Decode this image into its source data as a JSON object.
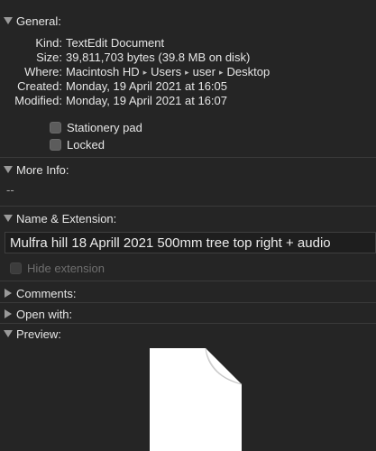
{
  "general": {
    "header": "General:",
    "kind_label": "Kind:",
    "kind_value": "TextEdit Document",
    "size_label": "Size:",
    "size_value": "39,811,703 bytes (39.8 MB on disk)",
    "where_label": "Where:",
    "where_path": [
      "Macintosh HD",
      "Users",
      "user",
      "Desktop"
    ],
    "created_label": "Created:",
    "created_value": "Monday, 19 April 2021 at 16:05",
    "modified_label": "Modified:",
    "modified_value": "Monday, 19 April 2021 at 16:07",
    "stationery_label": "Stationery pad",
    "locked_label": "Locked"
  },
  "more_info": {
    "header": "More Info:",
    "value": "--"
  },
  "name_extension": {
    "header": "Name & Extension:",
    "filename": "Mulfra hill 18 Aprill 2021 500mm tree top right + audio",
    "hide_extension_label": "Hide extension"
  },
  "comments": {
    "header": "Comments:"
  },
  "open_with": {
    "header": "Open with:"
  },
  "preview": {
    "header": "Preview:"
  },
  "icons": {
    "expanded": "disclosure-triangle-down-icon",
    "collapsed": "disclosure-triangle-right-icon",
    "path_separator": "path-arrow-icon",
    "document": "document-icon"
  },
  "colors": {
    "background": "#252525",
    "text": "#e6e6e6",
    "field_background": "#1e1e1e",
    "disabled_text": "#6e6e6e"
  }
}
